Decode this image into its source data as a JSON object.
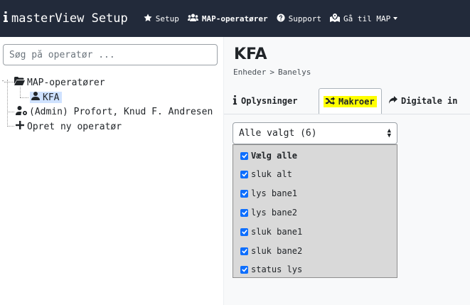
{
  "navbar": {
    "brand": "masterView Setup",
    "setup": "Setup",
    "map_operators": "MAP-operatører",
    "support": "Support",
    "goto_map": "Gå til MAP"
  },
  "search": {
    "placeholder": "Søg på operatør ..."
  },
  "tree": {
    "root": "MAP-operatører",
    "child": "KFA",
    "admin": "(Admin) Profort, Knud F. Andresen",
    "new_operator": "Opret ny operatør"
  },
  "detail": {
    "title": "KFA",
    "breadcrumb": [
      "Enheder",
      ">",
      "Banelys"
    ],
    "tabs": [
      "Oplysninger",
      "Makroer",
      "Digitale in"
    ],
    "active_tab": "Makroer"
  },
  "macro_select": {
    "value": "Alle valgt (6)",
    "options": [
      {
        "label": "Vælg alle",
        "checked": true
      },
      {
        "label": "sluk alt",
        "checked": true
      },
      {
        "label": "lys bane1",
        "checked": true
      },
      {
        "label": "lys bane2",
        "checked": true
      },
      {
        "label": "sluk bane1",
        "checked": true
      },
      {
        "label": "sluk bane2",
        "checked": true
      },
      {
        "label": "status lys",
        "checked": true
      }
    ]
  },
  "colors": {
    "navbar": "#222a3a",
    "accent": "#0d6efd",
    "highlight": "#ffff00"
  }
}
